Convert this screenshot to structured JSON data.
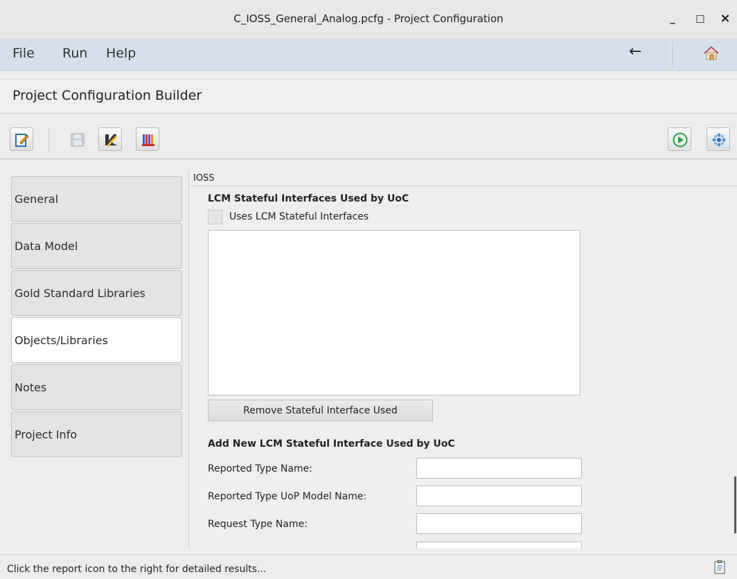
{
  "window": {
    "title": "C_IOSS_General_Analog.pcfg - Project Configuration",
    "minimize": "_",
    "maximize": "□",
    "close": "×"
  },
  "menubar": {
    "items": [
      "File",
      "Run",
      "Help"
    ],
    "back_icon": "←"
  },
  "header": {
    "title": "Project Configuration Builder"
  },
  "toolbar": {
    "icons": [
      "edit-icon",
      "save-icon",
      "report-edit-icon",
      "books-icon",
      "run-icon",
      "settings-icon"
    ]
  },
  "sidebar": {
    "items": [
      {
        "label": "General"
      },
      {
        "label": "Data Model"
      },
      {
        "label": "Gold Standard Libraries"
      },
      {
        "label": "Objects/Libraries",
        "active": true
      },
      {
        "label": "Notes"
      },
      {
        "label": "Project Info"
      }
    ]
  },
  "panel": {
    "label": "IOSS",
    "section1_title": "LCM Stateful Interfaces Used by UoC",
    "checkbox_label": "Uses LCM Stateful Interfaces",
    "checkbox_checked": false,
    "remove_button": "Remove Stateful Interface Used",
    "section2_title": "Add New LCM Stateful Interface Used by UoC",
    "fields": [
      {
        "label": "Reported Type Name:",
        "value": ""
      },
      {
        "label": "Reported Type UoP Model Name:",
        "value": ""
      },
      {
        "label": "Request Type Name:",
        "value": ""
      }
    ]
  },
  "status": {
    "text": "Click the report icon to the right for detailed results..."
  },
  "colors": {
    "menubar_bg": "#d6e0ec",
    "run_green": "#2ea043",
    "active_tab_bg": "#ffffff"
  }
}
